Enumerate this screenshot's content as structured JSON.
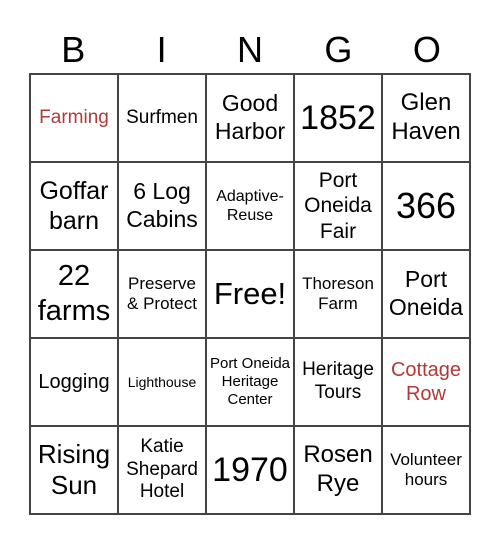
{
  "header": [
    "B",
    "I",
    "N",
    "G",
    "O"
  ],
  "accent_color": "#b03a3a",
  "cells": [
    {
      "text": "Farming",
      "size": 19,
      "red": true
    },
    {
      "text": "Surfmen",
      "size": 19
    },
    {
      "text": "Good Harbor",
      "size": 23
    },
    {
      "text": "1852",
      "size": 34
    },
    {
      "text": "Glen Haven",
      "size": 24
    },
    {
      "text": "Goffar barn",
      "size": 25
    },
    {
      "text": "6 Log Cabins",
      "size": 23
    },
    {
      "text": "Adaptive-Reuse",
      "size": 16
    },
    {
      "text": "Port Oneida Fair",
      "size": 21
    },
    {
      "text": "366",
      "size": 36
    },
    {
      "text": "22 farms",
      "size": 29
    },
    {
      "text": "Preserve & Protect",
      "size": 17
    },
    {
      "text": "Free!",
      "size": 31
    },
    {
      "text": "Thoreson Farm",
      "size": 17
    },
    {
      "text": "Port Oneida",
      "size": 23
    },
    {
      "text": "Logging",
      "size": 20
    },
    {
      "text": "Lighthouse",
      "size": 14
    },
    {
      "text": "Port Oneida Heritage Center",
      "size": 15
    },
    {
      "text": "Heritage Tours",
      "size": 19
    },
    {
      "text": "Cottage Row",
      "size": 20,
      "red": true
    },
    {
      "text": "Rising Sun",
      "size": 26
    },
    {
      "text": "Katie Shepard Hotel",
      "size": 19
    },
    {
      "text": "1970",
      "size": 34
    },
    {
      "text": "Rosen Rye",
      "size": 24
    },
    {
      "text": "Volunteer hours",
      "size": 17
    }
  ]
}
